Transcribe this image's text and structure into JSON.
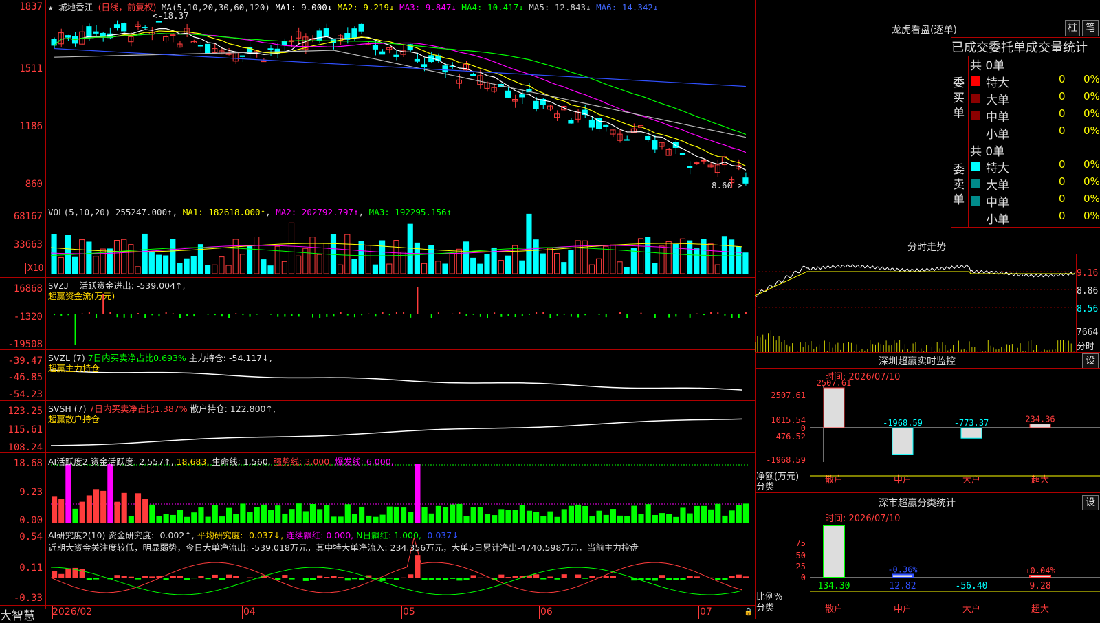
{
  "stock": {
    "name": "城地香江",
    "mode": "(日线，前复权)",
    "ma_prefix": "MA(5,10,20,30,60,120)",
    "ma": [
      {
        "label": "MA1: 9.000↓",
        "color": "#ffffff"
      },
      {
        "label": "MA2: 9.219↓",
        "color": "#ffff00"
      },
      {
        "label": "MA3: 9.847↓",
        "color": "#ff00ff"
      },
      {
        "label": "MA4: 10.417↓",
        "color": "#00ff00"
      },
      {
        "label": "MA5: 12.843↓",
        "color": "#cccccc"
      },
      {
        "label": "MA6: 14.342↓",
        "color": "#4169ff"
      }
    ],
    "high_label": "18.37",
    "low_label": "8.60",
    "price_axis": [
      "1837",
      "1511",
      "1186",
      "860"
    ]
  },
  "vol": {
    "prefix": "VOL(5,10,20)",
    "value": "255247.000↑",
    "ma1": "MA1: 182618.000↑",
    "ma2": "MA2: 202792.797↑",
    "ma3": "MA3: 192295.156↑",
    "axis": [
      "68167",
      "33663"
    ],
    "unit": "X10"
  },
  "svzj": {
    "prefix": "SVZJ",
    "line": "活跃资金进出: -539.004↑,",
    "sub": "超赢资金流(万元)",
    "axis": [
      "16868",
      "-1320",
      "-19508"
    ]
  },
  "svzl": {
    "prefix": "SVZL (7)",
    "ratio": "7日内买卖净占比0.693%",
    "line": "主力持仓: -54.117↓,",
    "sub": "超赢主力持仓",
    "axis": [
      "-39.47",
      "-46.85",
      "-54.23"
    ]
  },
  "svsh": {
    "prefix": "SVSH (7)",
    "ratio": "7日内买卖净占比1.387%",
    "line": "散户持仓: 122.800↑,",
    "sub": "超赢散户持仓",
    "axis": [
      "123.25",
      "115.61",
      "108.24"
    ]
  },
  "ai_active": {
    "prefix": "AI活跃度2",
    "a": "资金活跃度: 2.557↑,",
    "b": "18.683,",
    "c": "生命线: 1.560,",
    "d": "强势线: 3.000,",
    "e": "爆发线: 6.000,",
    "axis": [
      "18.68",
      "9.23",
      "0.00"
    ]
  },
  "ai_research": {
    "prefix": "AI研究度2(10)",
    "a": "资金研究度: -0.002↑,",
    "b": "平均研究度: -0.037↓,",
    "c": "连续飘红: 0.000,",
    "d": "N日飘红: 1.000,",
    "e": "-0.037↓",
    "note": "近期大资金关注度较低，明显弱势，今日大单净流出: -539.018万元，其中特大单净流入: 234.356万元，大单5日累计净出-4740.598万元，当前主力控盘",
    "axis": [
      "0.54",
      "0.11",
      "-0.33"
    ]
  },
  "bottom": {
    "brand": "大智慧",
    "dates": [
      "2026/02",
      "04",
      "05",
      "06",
      "07"
    ]
  },
  "lhb": {
    "title": "龙虎看盘(逐单)",
    "btn1": "柱",
    "btn2": "笔",
    "header": "已成交委托单成交量统计",
    "buy_label": "委买单",
    "sell_label": "委卖单",
    "buy_total": "共 0单",
    "sell_total": "共 0单",
    "rows": [
      {
        "name": "特大",
        "count": "0",
        "pct": "0%"
      },
      {
        "name": "大单",
        "count": "0",
        "pct": "0%"
      },
      {
        "name": "中单",
        "count": "0",
        "pct": "0%"
      },
      {
        "name": "小单",
        "count": "0",
        "pct": "0%"
      }
    ],
    "buy_colors": [
      "#ff0000",
      "#8b0000",
      "#8b0000",
      ""
    ],
    "sell_colors": [
      "#00ffff",
      "#008b8b",
      "#008b8b",
      ""
    ]
  },
  "intraday": {
    "title": "分时走势",
    "axis": [
      "9.16",
      "8.86",
      "8.56"
    ],
    "vol_label": "7664",
    "unit": "分时"
  },
  "sz_monitor": {
    "title": "深圳超赢实时监控",
    "btn": "设",
    "time": "时间: 2026/07/10",
    "axis": [
      "2507.61",
      "1015.54",
      "0",
      "-476.52",
      "-1968.59"
    ],
    "ylabel": "净额(万元)",
    "xlabel": "分类",
    "bars": [
      {
        "name": "散户",
        "value": 2507.61,
        "label": "2507.61",
        "color": "#ff3c3c"
      },
      {
        "name": "中户",
        "value": -1968.59,
        "label": "-1968.59",
        "color": "#00ffff"
      },
      {
        "name": "大户",
        "value": -773.37,
        "label": "-773.37",
        "color": "#00ffff"
      },
      {
        "name": "超大",
        "value": 234.36,
        "label": "234.36",
        "color": "#ff3c3c"
      }
    ]
  },
  "sz_stats": {
    "title": "深市超赢分类统计",
    "btn": "设",
    "time": "时间: 2026/07/10",
    "axis": [
      "75",
      "50",
      "25",
      "0"
    ],
    "ylabel": "比例%",
    "xlabel": "分类",
    "bars": [
      {
        "name": "散户",
        "pct": "",
        "value": "134.30",
        "level": 100,
        "color": "#00ff00"
      },
      {
        "name": "中户",
        "pct": "-0.36%",
        "value": "12.82",
        "level": 6,
        "color": "#3050ff"
      },
      {
        "name": "大户",
        "pct": "",
        "value": "-56.40",
        "level": 0,
        "color": "#00ffff"
      },
      {
        "name": "超大",
        "pct": "+0.04%",
        "value": "9.28",
        "level": 4,
        "color": "#ff3c3c"
      }
    ]
  },
  "colors": {
    "up": "#ff3c3c",
    "down": "#00ffff",
    "grid": "#b00000"
  }
}
